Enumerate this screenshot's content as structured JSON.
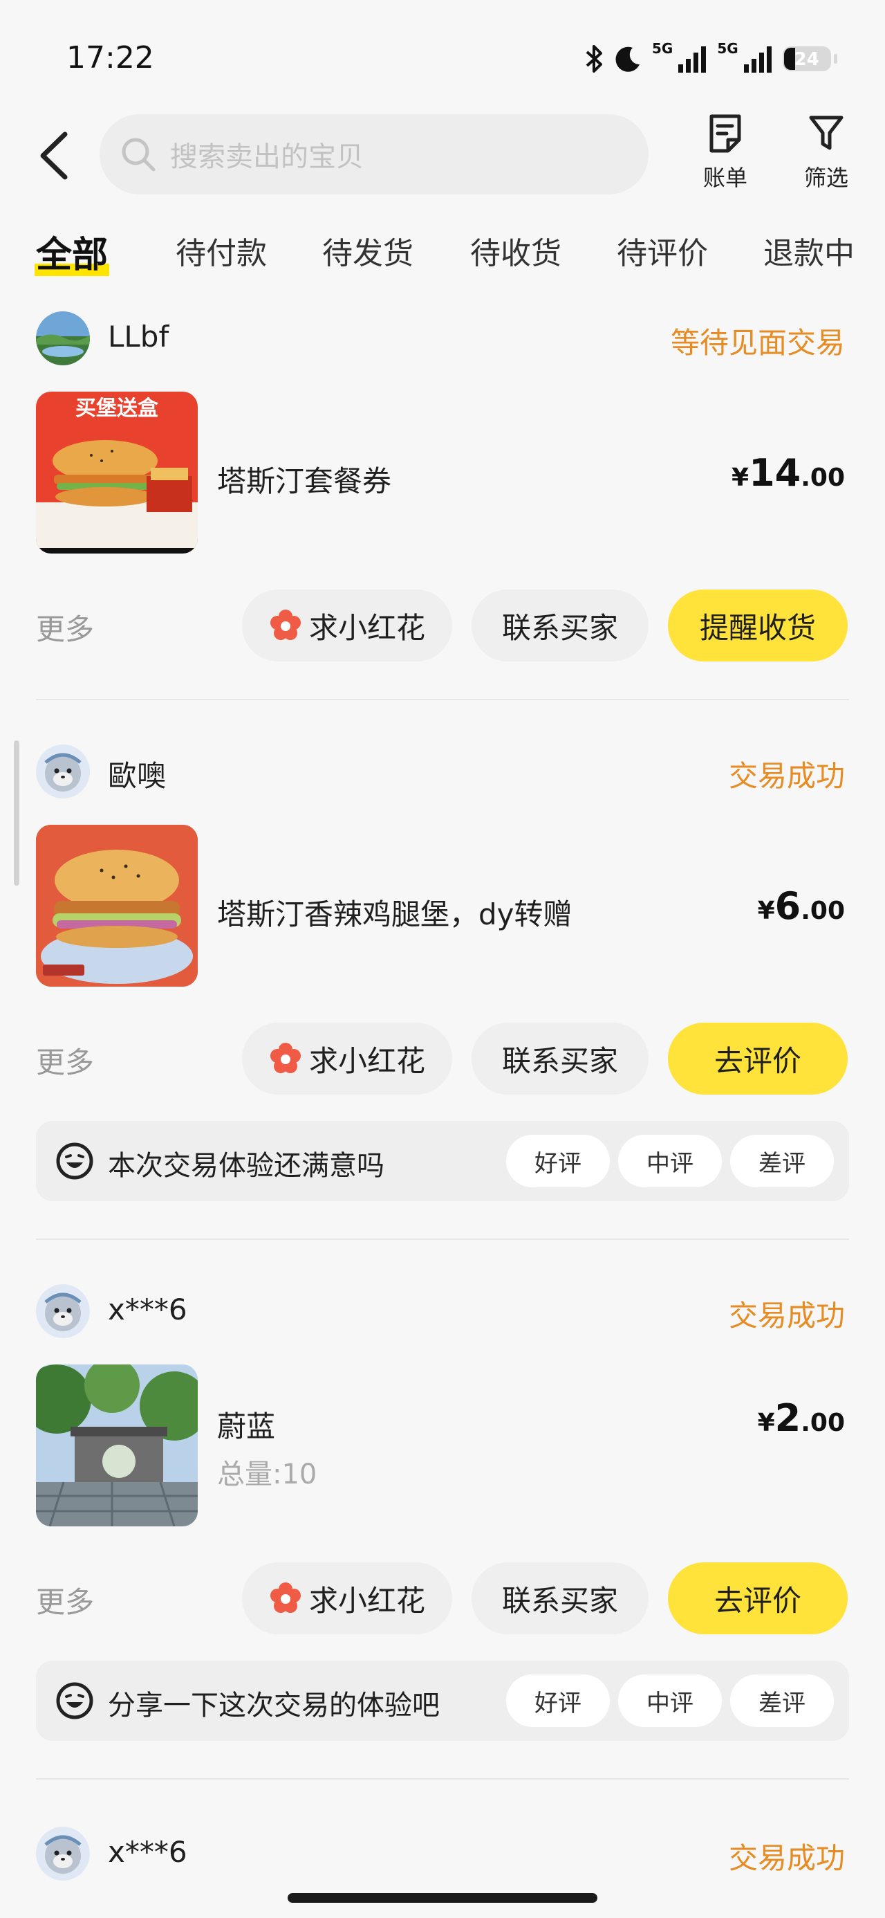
{
  "status_bar": {
    "time": "17:22",
    "network_1": "5G",
    "network_2": "5G",
    "battery": "24"
  },
  "header": {
    "search_placeholder": "搜索卖出的宝贝",
    "bill_label": "账单",
    "filter_label": "筛选"
  },
  "tabs": [
    "全部",
    "待付款",
    "待发货",
    "待收货",
    "待评价",
    "退款中"
  ],
  "orders": [
    {
      "user": "LLbf",
      "status": "等待见面交易",
      "title": "塔斯汀套餐券",
      "thumb_caption": "买堡送盒",
      "price_currency": "¥",
      "price_int": "14",
      "price_dec": ".00",
      "more": "更多",
      "btn_flower": "求小红花",
      "btn_contact": "联系买家",
      "btn_primary": "提醒收货"
    },
    {
      "user": "歐噢",
      "status": "交易成功",
      "title": "塔斯汀香辣鸡腿堡，dy转赠",
      "price_currency": "¥",
      "price_int": "6",
      "price_dec": ".00",
      "more": "更多",
      "btn_flower": "求小红花",
      "btn_contact": "联系买家",
      "btn_primary": "去评价",
      "review_question": "本次交易体验还满意吗",
      "review_good": "好评",
      "review_mid": "中评",
      "review_bad": "差评"
    },
    {
      "user": "x***6",
      "status": "交易成功",
      "title": "蔚蓝",
      "subtitle": "总量:10",
      "price_currency": "¥",
      "price_int": "2",
      "price_dec": ".00",
      "more": "更多",
      "btn_flower": "求小红花",
      "btn_contact": "联系买家",
      "btn_primary": "去评价",
      "review_question": "分享一下这次交易的体验吧",
      "review_good": "好评",
      "review_mid": "中评",
      "review_bad": "差评"
    },
    {
      "user": "x***6",
      "status": "交易成功"
    }
  ],
  "colors": {
    "accent_yellow": "#ffe33a",
    "status_orange": "#e78b23",
    "flower_red": "#ef5b45"
  }
}
